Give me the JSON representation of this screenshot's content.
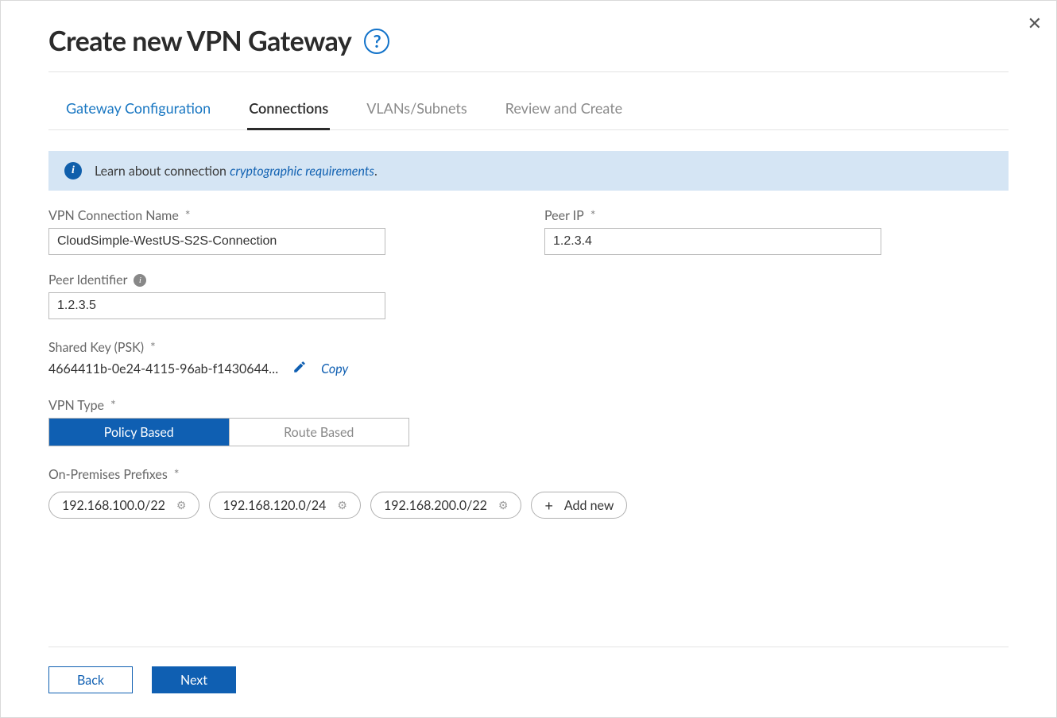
{
  "title": "Create new VPN Gateway",
  "tabs": {
    "gateway": "Gateway Configuration",
    "connections": "Connections",
    "vlans": "VLANs/Subnets",
    "review": "Review and Create"
  },
  "banner": {
    "lead": "Learn about connection ",
    "link": "cryptographic requirements",
    "tail": "."
  },
  "labels": {
    "conn_name": "VPN Connection Name",
    "peer_ip": "Peer IP",
    "peer_id": "Peer Identifier",
    "psk": "Shared Key  (PSK)",
    "vpn_type": "VPN Type",
    "prefixes": "On-Premises Prefixes",
    "asterisk": "*"
  },
  "values": {
    "conn_name": "CloudSimple-WestUS-S2S-Connection",
    "peer_ip": "1.2.3.4",
    "peer_id": "1.2.3.5",
    "psk": "4664411b-0e24-4115-96ab-f1430644…"
  },
  "actions": {
    "copy": "Copy",
    "add_new": "Add new",
    "back": "Back",
    "next": "Next"
  },
  "vpn_type": {
    "policy": "Policy Based",
    "route": "Route Based"
  },
  "prefixes": [
    "192.168.100.0/22",
    "192.168.120.0/24",
    "192.168.200.0/22"
  ]
}
